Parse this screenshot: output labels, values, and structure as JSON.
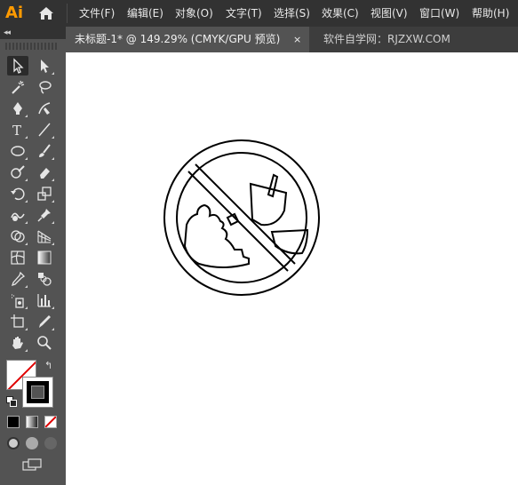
{
  "app": {
    "logo": "Ai",
    "home_icon": "home-icon"
  },
  "menu": [
    "文件(F)",
    "编辑(E)",
    "对象(O)",
    "文字(T)",
    "选择(S)",
    "效果(C)",
    "视图(V)",
    "窗口(W)",
    "帮助(H)"
  ],
  "tabs": {
    "active": "未标题-1* @ 149.29% (CMYK/GPU 预览)",
    "close_glyph": "×",
    "inactive": "软件自学网：RJZXW.COM"
  },
  "panel": {
    "collapse_glyph": "◂◂"
  },
  "tools": [
    [
      "selection-tool-icon",
      "direct-selection-tool-icon"
    ],
    [
      "magic-wand-tool-icon",
      "lasso-tool-icon"
    ],
    [
      "pen-tool-icon",
      "curvature-tool-icon"
    ],
    [
      "type-tool-icon",
      "line-segment-tool-icon"
    ],
    [
      "ellipse-tool-icon",
      "paintbrush-tool-icon"
    ],
    [
      "shaper-tool-icon",
      "eraser-tool-icon"
    ],
    [
      "rotate-tool-icon",
      "scale-tool-icon"
    ],
    [
      "warp-tool-icon",
      "puppet-warp-tool-icon"
    ],
    [
      "shape-builder-tool-icon",
      "perspective-grid-tool-icon"
    ],
    [
      "mesh-tool-icon",
      "gradient-tool-icon"
    ],
    [
      "eyedropper-tool-icon",
      "blend-tool-icon"
    ],
    [
      "symbol-sprayer-tool-icon",
      "column-graph-tool-icon"
    ],
    [
      "artboard-tool-icon",
      "slice-tool-icon"
    ],
    [
      "hand-tool-icon",
      "zoom-tool-icon"
    ]
  ],
  "type_tool_glyph": "T",
  "swap_glyph": "↰",
  "colors": {
    "menubar": "#323232",
    "panel": "#535353",
    "canvas": "#ffffff",
    "logo": "#ff9a00",
    "none_slash": "#e00000"
  }
}
